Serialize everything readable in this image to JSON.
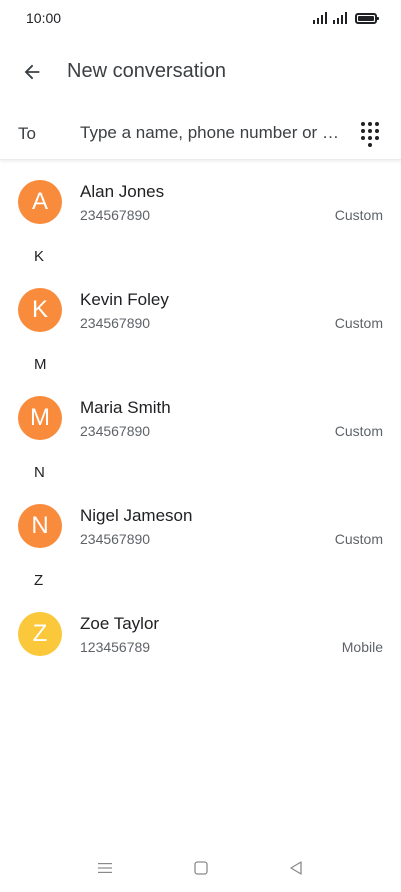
{
  "status_bar": {
    "time": "10:00",
    "icons": [
      "signal-icon",
      "signal-icon",
      "battery-icon"
    ]
  },
  "header": {
    "back_icon": "arrow-left-icon",
    "title": "New conversation"
  },
  "to_field": {
    "label": "To",
    "placeholder": "Type a name, phone number or email",
    "value": "",
    "dialpad_icon": "dialpad-icon"
  },
  "colors": {
    "avatar_orange": "#f98b3c",
    "avatar_yellow": "#fbc73b"
  },
  "contacts": [
    {
      "initial": "A",
      "name": "Alan Jones",
      "number": "234567890",
      "type": "Custom",
      "color": "#f98b3c"
    },
    {
      "section": "K"
    },
    {
      "initial": "K",
      "name": "Kevin Foley",
      "number": "234567890",
      "type": "Custom",
      "color": "#f98b3c"
    },
    {
      "section": "M"
    },
    {
      "initial": "M",
      "name": "Maria Smith",
      "number": "234567890",
      "type": "Custom",
      "color": "#f98b3c"
    },
    {
      "section": "N"
    },
    {
      "initial": "N",
      "name": "Nigel Jameson",
      "number": "234567890",
      "type": "Custom",
      "color": "#f98b3c"
    },
    {
      "section": "Z"
    },
    {
      "initial": "Z",
      "name": "Zoe Taylor",
      "number": "123456789",
      "type": "Mobile",
      "color": "#fbc73b"
    }
  ],
  "nav_bar": {
    "icons": [
      "menu-icon",
      "home-square-icon",
      "back-triangle-icon"
    ]
  }
}
